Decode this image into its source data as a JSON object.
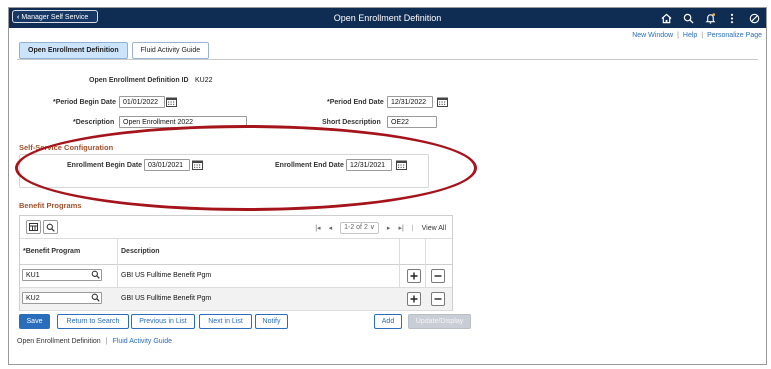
{
  "header": {
    "back_label": "Manager Self Service",
    "title": "Open Enrollment Definition",
    "icons": [
      "home-icon",
      "search-icon",
      "notification-bell-icon",
      "more-actions-icon",
      "navbar-icon"
    ]
  },
  "top_links": {
    "new_window": "New Window",
    "help": "Help",
    "personalize": "Personalize Page"
  },
  "tabs": [
    {
      "label": "Open Enrollment Definition",
      "active": true
    },
    {
      "label": "Fluid Activity Guide",
      "active": false
    }
  ],
  "form": {
    "id_label": "Open Enrollment Definition ID",
    "id_value": "KU22",
    "period_begin_label": "*Period Begin Date",
    "period_begin_value": "01/01/2022",
    "period_end_label": "*Period End Date",
    "period_end_value": "12/31/2022",
    "description_label": "*Description",
    "description_value": "Open Enrollment 2022",
    "short_description_label": "Short Description",
    "short_description_value": "OE22"
  },
  "self_service": {
    "title": "Self-Service Configuration",
    "enroll_begin_label": "Enrollment Begin Date",
    "enroll_begin_value": "03/01/2021",
    "enroll_end_label": "Enrollment End Date",
    "enroll_end_value": "12/31/2021"
  },
  "benefit_programs": {
    "title": "Benefit Programs",
    "pager": {
      "range": "1-2 of 2",
      "view_all": "View All"
    },
    "columns": [
      "*Benefit Program",
      "Description"
    ],
    "rows": [
      {
        "program": "KU1",
        "description": "GBI US Fulltime Benefit Pgm"
      },
      {
        "program": "KU2",
        "description": "GBI US Fulltime Benefit Pgm"
      }
    ]
  },
  "buttons": {
    "save": "Save",
    "return_to_search": "Return to Search",
    "previous_in_list": "Previous in List",
    "next_in_list": "Next in List",
    "notify": "Notify",
    "add": "Add",
    "update_display": "Update/Display"
  },
  "footer": {
    "link1": "Open Enrollment Definition",
    "link2": "Fluid Activity Guide"
  },
  "colors": {
    "header_bg": "#0f2c52",
    "accent": "#2a6ebb",
    "section_title": "#a0522d",
    "annotation_oval": "#a4141a"
  }
}
